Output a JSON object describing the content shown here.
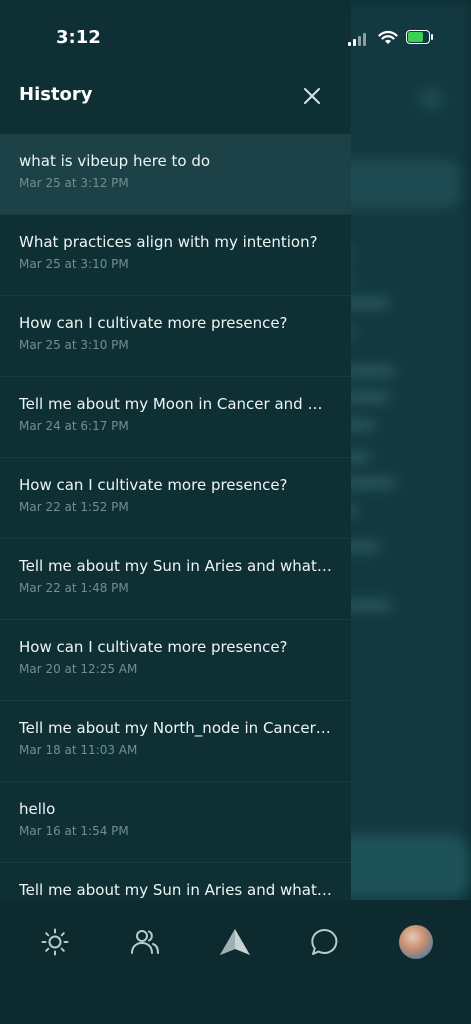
{
  "status": {
    "time": "3:12"
  },
  "drawer": {
    "title": "History",
    "items": [
      {
        "title": "what is vibeup here to do",
        "date": "Mar 25 at 3:12 PM"
      },
      {
        "title": "What practices align with my intention?",
        "date": "Mar 25 at 3:10 PM"
      },
      {
        "title": "How can I cultivate more presence?",
        "date": "Mar 25 at 3:10 PM"
      },
      {
        "title": "Tell me about my Moon in Cancer and wh...",
        "date": "Mar 24 at 6:17 PM"
      },
      {
        "title": "How can I cultivate more presence?",
        "date": "Mar 22 at 1:52 PM"
      },
      {
        "title": "Tell me about my Sun in Aries and what it ...",
        "date": "Mar 22 at 1:48 PM"
      },
      {
        "title": "How can I cultivate more presence?",
        "date": "Mar 20 at 12:25 AM"
      },
      {
        "title": "Tell me about my North_node in Cancer a...",
        "date": "Mar 18 at 11:03 AM"
      },
      {
        "title": "hello",
        "date": "Mar 16 at 1:54 PM"
      },
      {
        "title": "Tell me about my Sun in Aries and what it ...",
        "date": ""
      }
    ]
  },
  "nav": {
    "icons": [
      "sun-icon",
      "people-icon",
      "triangle-icon",
      "chat-icon",
      "avatar"
    ]
  }
}
